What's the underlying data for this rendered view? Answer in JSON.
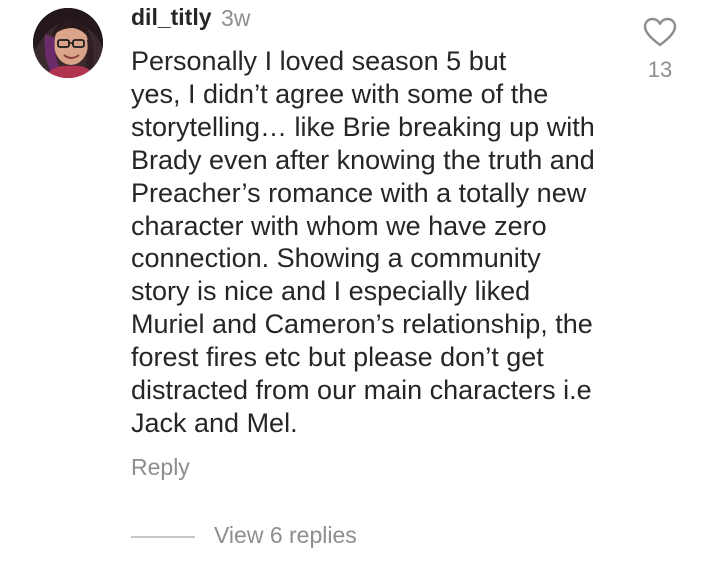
{
  "comment": {
    "username": "dil_titly",
    "time_ago": "3w",
    "text": "Personally I loved season 5 but\nyes, I didn’t agree with some of the\nstorytelling… like Brie breaking up with\nBrady even after knowing the truth and\nPreacher’s romance with a totally new\ncharacter with whom we have zero\nconnection. Showing a community\nstory is nice and I especially liked\nMuriel and Cameron’s relationship, the\nforest fires etc but please don’t get\ndistracted from our main characters i.e\nJack and Mel.",
    "like_count": "13",
    "reply_label": "Reply",
    "view_replies_label": "View 6 replies",
    "like_icon": "heart-outline-icon",
    "avatar_icon": "user-photo"
  },
  "colors": {
    "primary_text": "#262626",
    "secondary_text": "#8e8e8e",
    "divider": "#c7c7c7"
  }
}
